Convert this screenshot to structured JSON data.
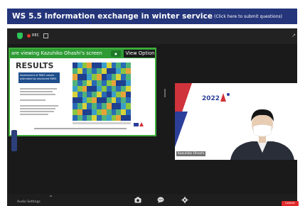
{
  "header": {
    "title": "WS 5.5 Information exchange in winter service",
    "subtitle_link": "(Click here to submit questions)",
    "bg_color": "#24357a"
  },
  "meeting": {
    "rec_label": "REC",
    "share_banner": "are viewing Kazuhiko Ohashi's screen",
    "view_options": "View Option",
    "participant_name": "Kazuhiko Ohashi",
    "audio_label": "Audio Settings",
    "leave_label": "Leave",
    "accent_green": "#3fae3a"
  },
  "slide": {
    "title": "RESULTS",
    "box_text": "Assessment of RWIS values estimated by advanced RWIS"
  },
  "icons": [
    "shield-icon",
    "grid-view-icon",
    "camera-icon",
    "chat-icon",
    "settings-icon",
    "caret-up-icon"
  ]
}
